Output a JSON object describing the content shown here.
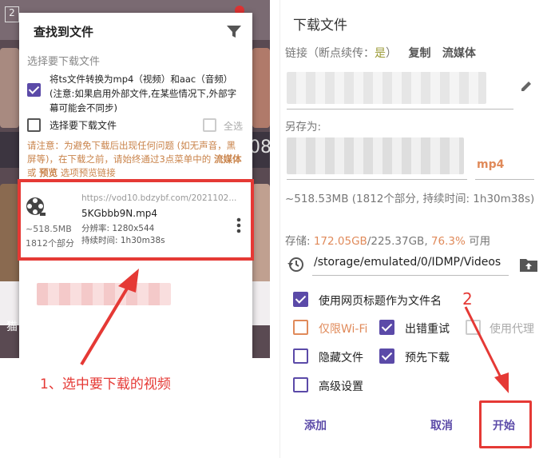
{
  "left": {
    "dialog_title": "查找到文件",
    "section_label": "选择要下载文件",
    "convert_option": "将ts文件转换为mp4（视频）和aac（音频）(注意:如果启用外部文件,在某些情况下,外部字幕可能会不同步)",
    "select_file_label": "选择要下载文件",
    "select_all_label": "全选",
    "warning_prefix": "请注意：为避免下载后出现任何问题 (如无声音，黑屏等)，在下载之前，请始终通过3点菜单中的",
    "warning_link1": "流媒体",
    "warning_or": " 或 ",
    "warning_link2": "预览",
    "warning_suffix": " 选项预览链接",
    "file": {
      "url": "https://vod10.bdzybf.com/2021102...",
      "name": "5KGbbb9N.mp4",
      "size": "~518.5MB",
      "parts": "1812个部分",
      "resolution": "分辨率: 1280x544",
      "duration": "持续时间:   1h30m38s"
    },
    "bg_text_left": "猫",
    "bg_text_right": "08",
    "bg_text_top": "2",
    "annotation": "1、选中要下载的视频"
  },
  "right": {
    "title": "下载文件",
    "link_label": "链接（断点续传：",
    "link_resume": "是",
    "link_close": "）",
    "copy_label": "复制",
    "stream_label": "流媒体",
    "save_as_label": "另存为:",
    "ext": "mp4",
    "size_info": "~518.53MB (1812个部分, 持续时间: 1h30m38s)",
    "storage_label": "存储: ",
    "storage_free": "172.05GB",
    "storage_total": "/225.37GB, ",
    "storage_pct": "76.3%",
    "storage_suffix": " 可用",
    "path": "/storage/emulated/0/IDMP/Videos",
    "options": {
      "use_title": "使用网页标题作为文件名",
      "wifi_only": "仅限Wi-Fi",
      "retry": "出错重试",
      "use_proxy": "使用代理",
      "hide_file": "隐藏文件",
      "pre_download": "预先下载",
      "advanced": "高级设置"
    },
    "add_button": "添加",
    "cancel_button": "取消",
    "start_button": "开始",
    "annotation_num": "2"
  },
  "colors": {
    "accent": "#5b4aa8",
    "warning": "#c9834a",
    "annotation_red": "#e53935",
    "storage_orange": "#e08a5a"
  }
}
